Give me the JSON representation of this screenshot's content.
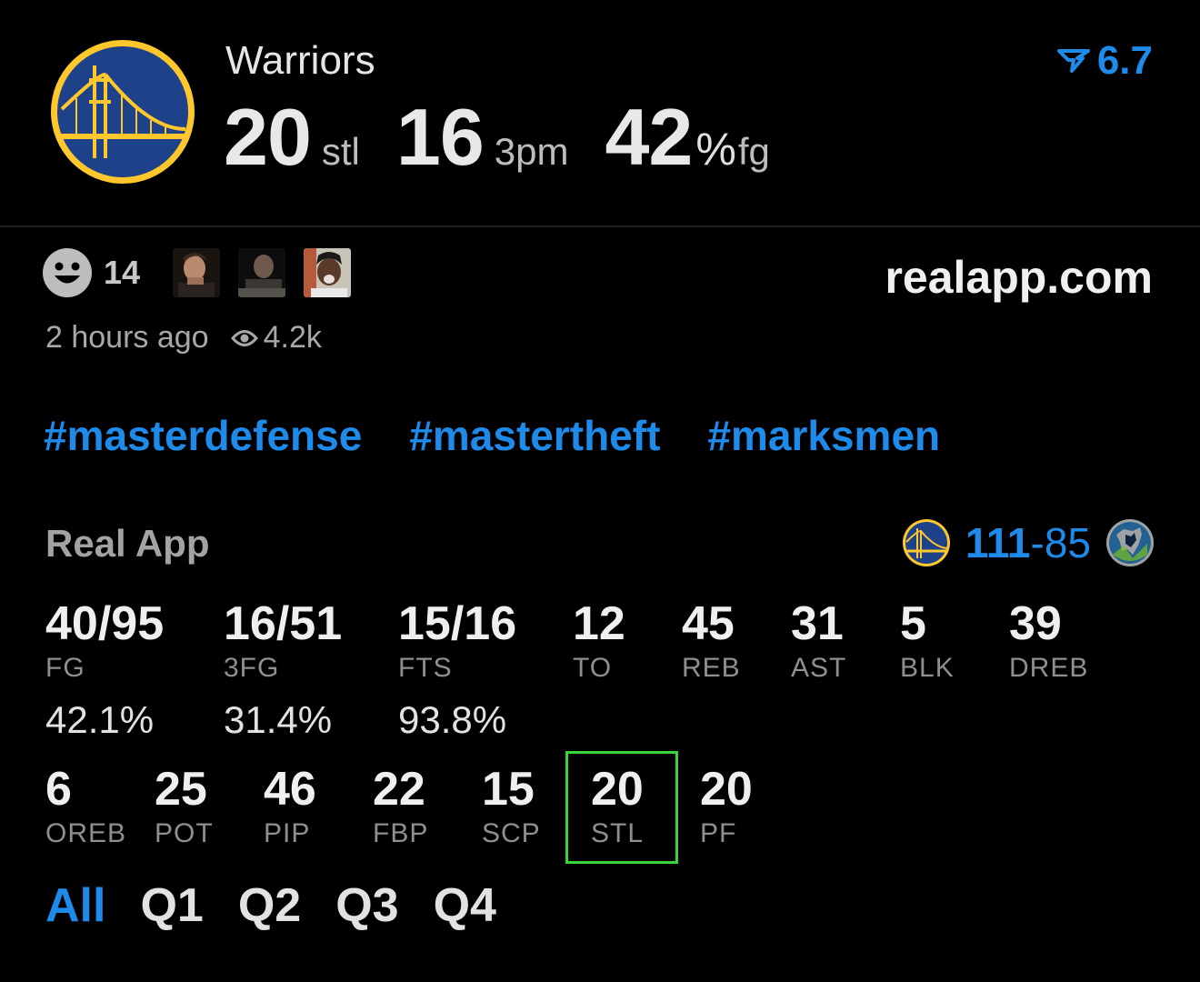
{
  "header": {
    "team": "Warriors",
    "stat1_value": "20",
    "stat1_unit": "stl",
    "stat2_value": "16",
    "stat2_unit": "3pm",
    "stat3_value": "42",
    "stat3_pct": "%",
    "stat3_unit": "fg",
    "rating": "6.7"
  },
  "post": {
    "reaction_count": "14",
    "site": "realapp.com",
    "time": "2 hours ago",
    "views": "4.2k",
    "hashtags": [
      "#masterdefense",
      "#mastertheft",
      "#marksmen"
    ]
  },
  "box": {
    "source": "Real App",
    "home_score": "111",
    "dash": "-",
    "away_score": "85",
    "row1": [
      {
        "value": "40/95",
        "label": "FG"
      },
      {
        "value": "16/51",
        "label": "3FG"
      },
      {
        "value": "15/16",
        "label": "FTS"
      },
      {
        "value": "12",
        "label": "TO"
      },
      {
        "value": "45",
        "label": "REB"
      },
      {
        "value": "31",
        "label": "AST"
      },
      {
        "value": "5",
        "label": "BLK"
      },
      {
        "value": "39",
        "label": "DREB"
      }
    ],
    "percentages": [
      "42.1%",
      "31.4%",
      "93.8%"
    ],
    "row2": [
      {
        "value": "6",
        "label": "OREB"
      },
      {
        "value": "25",
        "label": "POT"
      },
      {
        "value": "46",
        "label": "PIP"
      },
      {
        "value": "22",
        "label": "FBP"
      },
      {
        "value": "15",
        "label": "SCP"
      },
      {
        "value": "20",
        "label": "STL"
      },
      {
        "value": "20",
        "label": "PF"
      }
    ],
    "highlighted_stat": "STL"
  },
  "quarters": [
    "All",
    "Q1",
    "Q2",
    "Q3",
    "Q4"
  ],
  "active_quarter": "All",
  "colors": {
    "accent": "#1e8bea",
    "highlight": "#3cd23a",
    "warriors_blue": "#1d428a",
    "warriors_gold": "#ffc72c"
  },
  "icons": {
    "team_logo": "warriors-bridge-icon",
    "rating": "real-app-logo-icon",
    "reaction": "smiley-icon",
    "views": "eye-icon",
    "opponent_logo": "timberwolves-icon"
  }
}
